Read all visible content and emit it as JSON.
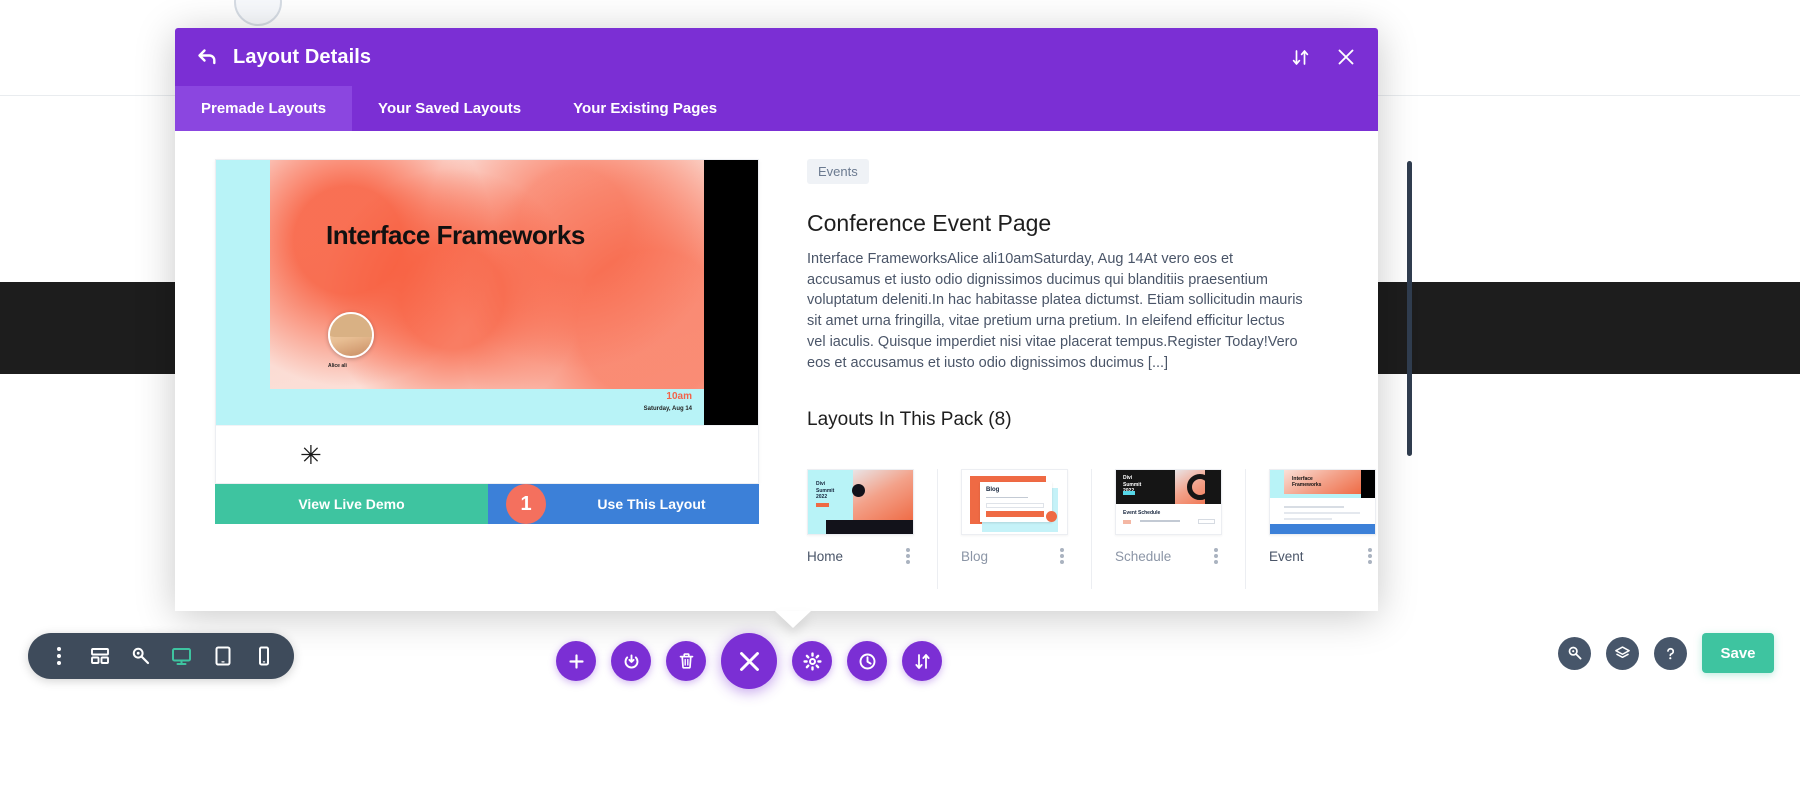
{
  "modal": {
    "title": "Layout Details",
    "back_icon": "back-arrow-icon",
    "sort_icon": "sort-updown-icon",
    "close_icon": "close-icon",
    "tabs": [
      {
        "label": "Premade Layouts",
        "active": true
      },
      {
        "label": "Your Saved Layouts",
        "active": false
      },
      {
        "label": "Your Existing Pages",
        "active": false
      }
    ]
  },
  "preview": {
    "shot": {
      "title": "Interface Frameworks",
      "avatar_name": "Alice ali",
      "time": "10am",
      "date": "Saturday, Aug 14",
      "asterisk": "✳"
    },
    "buttons": {
      "demo_label": "View Live Demo",
      "use_label": "Use This Layout",
      "step_number": "1"
    }
  },
  "details": {
    "category": "Events",
    "title": "Conference Event Page",
    "description": "Interface FrameworksAlice ali10amSaturday, Aug 14At vero eos et accusamus et iusto odio dignissimos ducimus qui blanditiis praesentium voluptatum deleniti.In hac habitasse platea dictumst. Etiam sollicitudin mauris sit amet urna fringilla, vitae pretium urna pretium. In eleifend efficitur lectus vel iaculis. Quisque imperdiet nisi vitae placerat tempus.Register Today!Vero eos et accusamus et iusto odio dignissimos ducimus [...]",
    "pack_heading": "Layouts In This Pack (8)",
    "thumbs": [
      {
        "name": "Home",
        "menu_icon": "kebab-menu-icon"
      },
      {
        "name": "Blog",
        "menu_icon": "kebab-menu-icon"
      },
      {
        "name": "Schedule",
        "menu_icon": "kebab-menu-icon"
      },
      {
        "name": "Event",
        "menu_icon": "kebab-menu-icon"
      }
    ],
    "thumb_art": {
      "home_title": "Divi\nSummit\n2022",
      "blog_title": "Blog",
      "schedule_title": "Divi\nSummit\n2022",
      "schedule_sub": "Event Schedule",
      "event_title": "Interface\nFrameworks"
    }
  },
  "toolbar": {
    "left_items": [
      {
        "icon": "kebab-menu-icon",
        "active": false
      },
      {
        "icon": "wireframe-icon",
        "active": false
      },
      {
        "icon": "magnifier-key-icon",
        "active": false
      },
      {
        "icon": "desktop-icon",
        "active": true
      },
      {
        "icon": "tablet-icon",
        "active": false
      },
      {
        "icon": "phone-icon",
        "active": false
      }
    ],
    "center_items": [
      {
        "icon": "plus-icon",
        "big": false
      },
      {
        "icon": "power-icon",
        "big": false
      },
      {
        "icon": "trash-icon",
        "big": false
      },
      {
        "icon": "close-x-icon",
        "big": true
      },
      {
        "icon": "gear-icon",
        "big": false
      },
      {
        "icon": "history-clock-icon",
        "big": false
      },
      {
        "icon": "sort-updown-icon",
        "big": false
      }
    ],
    "right_items": [
      {
        "icon": "search-icon"
      },
      {
        "icon": "layers-icon"
      },
      {
        "icon": "help-question-icon"
      }
    ],
    "save_label": "Save"
  },
  "colors": {
    "purple": "#7b2fd4",
    "purple_light": "#8b46e0",
    "teal": "#3ec4a0",
    "blue": "#3c80d8",
    "coral": "#f4705e",
    "dark_slate": "#3e4b5b"
  }
}
